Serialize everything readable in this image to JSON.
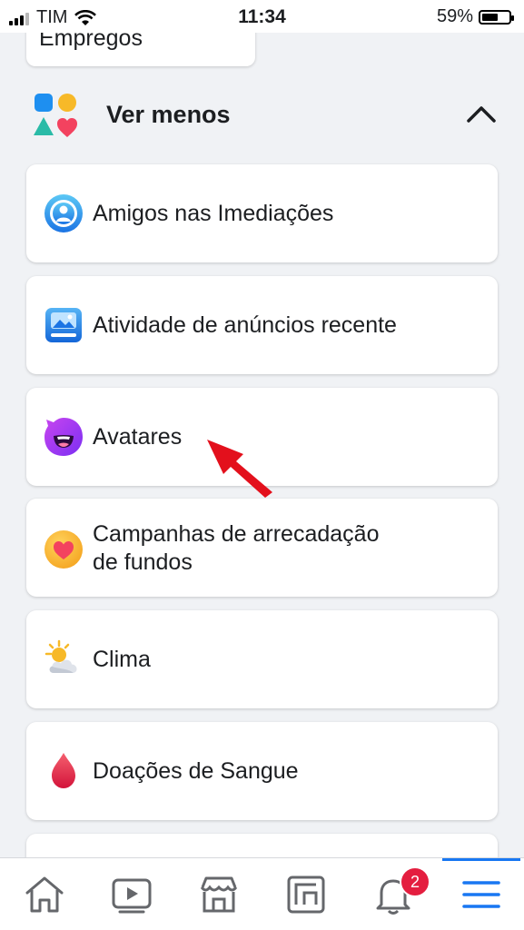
{
  "status_bar": {
    "carrier": "TIM",
    "time": "11:34",
    "battery": "59%",
    "battery_level": 0.59
  },
  "top_card": {
    "label": "Empregos"
  },
  "section": {
    "title": "Ver menos",
    "icon": "shapes-icon",
    "toggle_icon": "chevron-up-icon"
  },
  "menu_items": [
    {
      "label_lines": [
        "Amigos nas Imediações"
      ],
      "icon": "nearby-friends-icon"
    },
    {
      "label_lines": [
        "Atividade de anúncios recente"
      ],
      "icon": "ad-activity-icon"
    },
    {
      "label_lines": [
        "Avatares"
      ],
      "icon": "avatar-icon"
    },
    {
      "label_lines": [
        "Campanhas de arrecadação",
        "de fundos"
      ],
      "icon": "fundraiser-icon"
    },
    {
      "label_lines": [
        "Clima"
      ],
      "icon": "weather-icon"
    },
    {
      "label_lines": [
        "Doações de Sangue"
      ],
      "icon": "blood-drop-icon"
    }
  ],
  "bottom_nav": {
    "items": [
      "home-icon",
      "video-icon",
      "marketplace-icon",
      "gaming-icon",
      "notifications-icon",
      "menu-icon"
    ],
    "notification_badge": "2",
    "active": "menu-icon"
  },
  "colors": {
    "accent": "#1877f2",
    "badge": "#e41e3f",
    "annotation_arrow": "#e3101c"
  }
}
